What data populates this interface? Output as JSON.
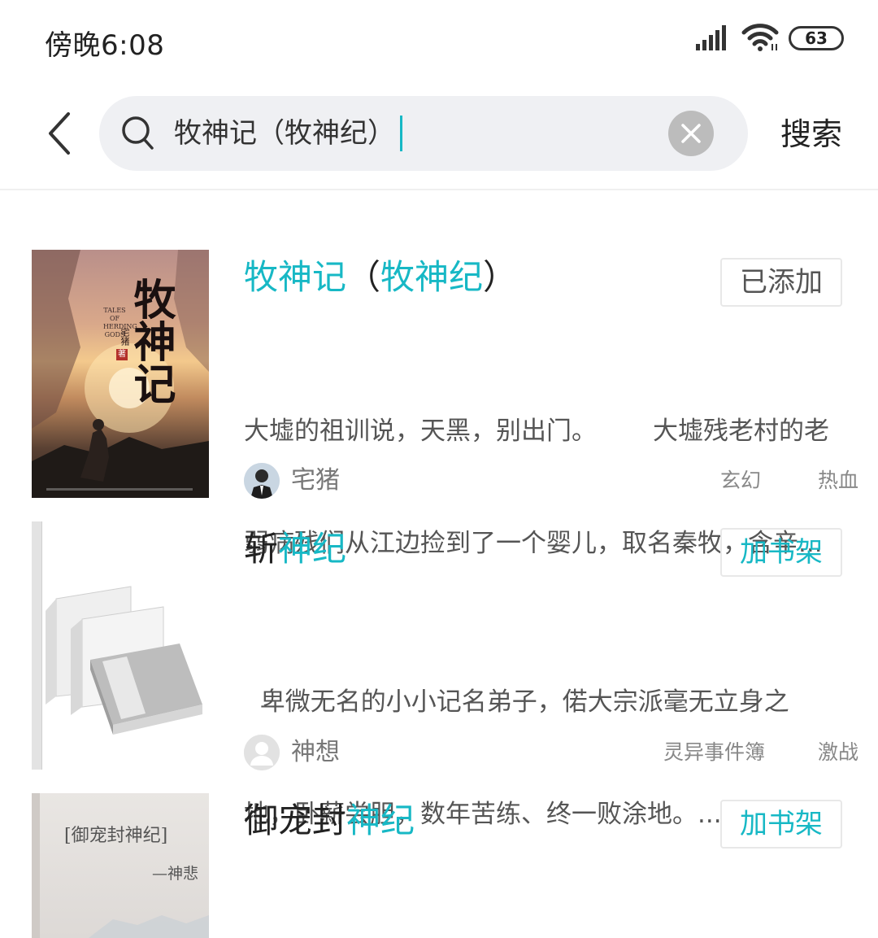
{
  "status_bar": {
    "time": "傍晚6:08",
    "battery": "63",
    "icons": [
      "signal-icon",
      "wifi-icon",
      "battery-icon"
    ]
  },
  "search": {
    "query": "牧神记（牧神纪）",
    "submit_label": "搜索",
    "icons": [
      "back-icon",
      "search-icon",
      "clear-icon"
    ]
  },
  "colors": {
    "accent": "#17b8c5",
    "search_bg": "#eff0f3"
  },
  "results": [
    {
      "title_parts": [
        "牧神记",
        "（",
        "牧神纪",
        "）"
      ],
      "action": "已添加",
      "description_line1": "大墟的祖训说，天黑，别出门。       大墟残老村的老",
      "description_line2": "弱病残们从江边捡到了一个婴儿，取名秦牧，含辛...",
      "author": "宅猪",
      "tags": [
        "玄幻",
        "热血"
      ],
      "cover": {
        "title": "牧神记",
        "subtitle": "TALES OF HERDING GODS",
        "author": "宅猪",
        "mark": "著"
      }
    },
    {
      "title_parts": [
        "斩",
        "神纪"
      ],
      "action": "加书架",
      "description_line1": "  卑微无名的小小记名弟子，偌大宗派毫无立身之",
      "description_line2": "地，卧薪尝胆，数年苦练、终一败涂地。...",
      "author": "神想",
      "tags": [
        "灵异事件簿",
        "激战"
      ]
    },
    {
      "title_parts": [
        "御宠封",
        "神纪"
      ],
      "action": "加书架",
      "cover": {
        "title": "[御宠封神纪]",
        "author": "—神悲"
      }
    }
  ]
}
